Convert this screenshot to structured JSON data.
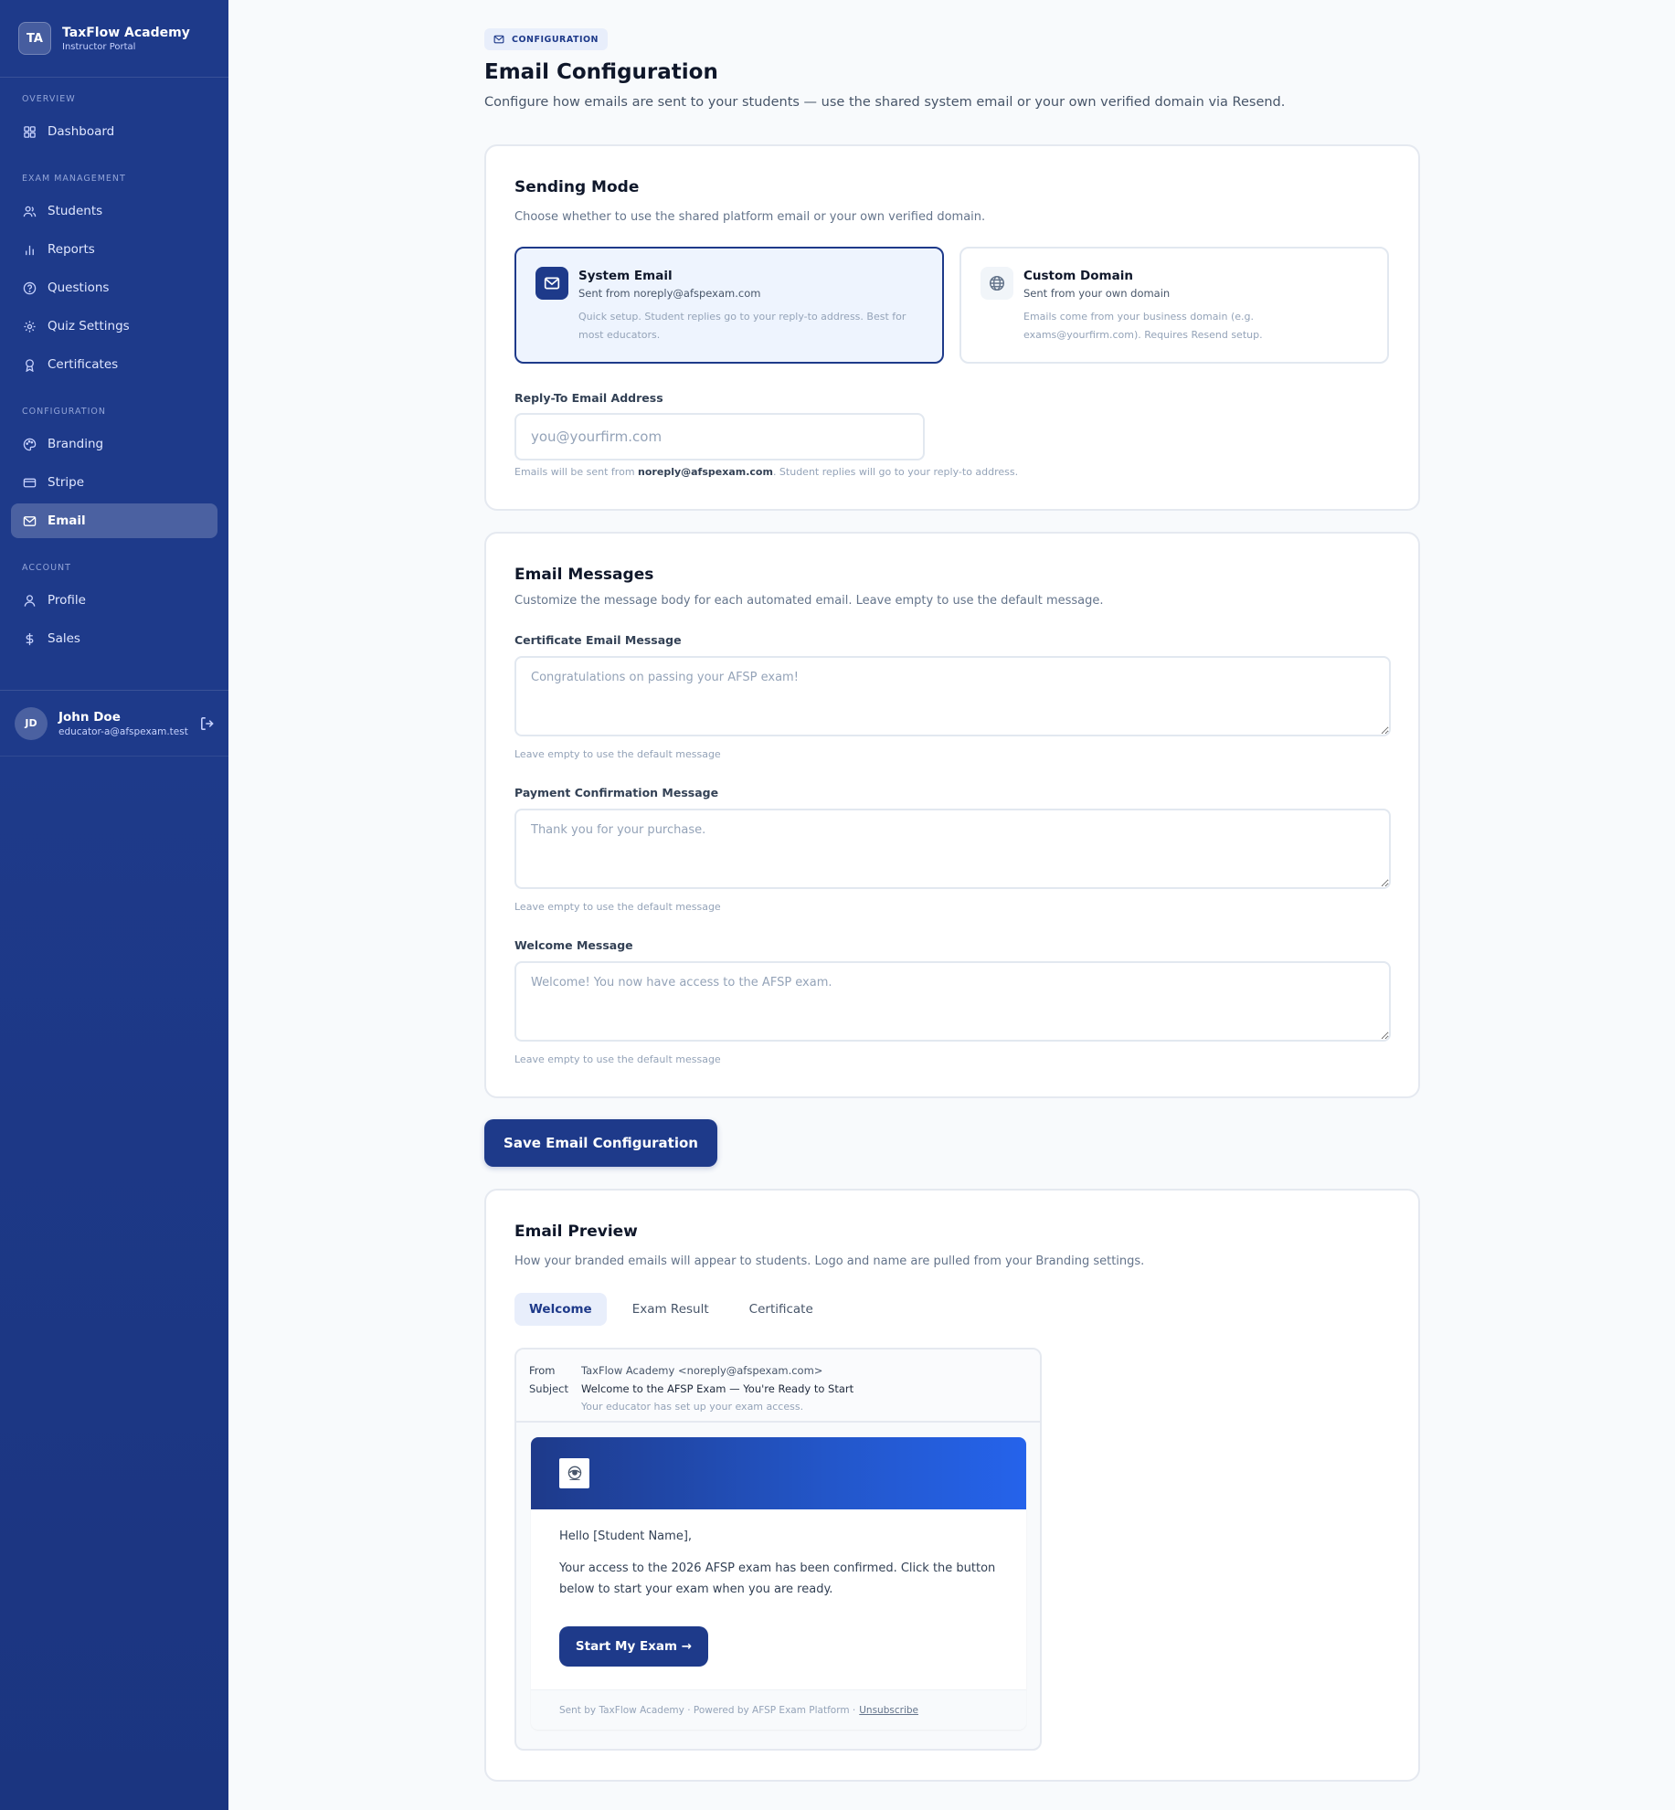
{
  "brand": {
    "initials": "TA",
    "name": "TaxFlow Academy",
    "subtitle": "Instructor Portal"
  },
  "nav": {
    "sections": [
      "OVERVIEW",
      "EXAM MANAGEMENT",
      "CONFIGURATION",
      "ACCOUNT"
    ],
    "items": [
      {
        "label": "Dashboard",
        "icon": "grid-icon"
      },
      {
        "label": "Students",
        "icon": "users-icon"
      },
      {
        "label": "Reports",
        "icon": "bar-chart-icon"
      },
      {
        "label": "Questions",
        "icon": "help-circle-icon"
      },
      {
        "label": "Quiz Settings",
        "icon": "gear-icon"
      },
      {
        "label": "Certificates",
        "icon": "award-icon"
      },
      {
        "label": "Branding",
        "icon": "palette-icon"
      },
      {
        "label": "Stripe",
        "icon": "credit-card-icon"
      },
      {
        "label": "Email",
        "icon": "mail-icon",
        "active": true
      },
      {
        "label": "Profile",
        "icon": "user-icon"
      },
      {
        "label": "Sales",
        "icon": "dollar-icon"
      }
    ]
  },
  "user": {
    "initials": "JD",
    "name": "John Doe",
    "email": "educator-a@afspexam.test"
  },
  "header": {
    "badge": "CONFIGURATION",
    "title": "Email Configuration",
    "subtitle": "Configure how emails are sent to your students — use the shared system email or your own verified domain via Resend."
  },
  "sending": {
    "title": "Sending Mode",
    "description": "Choose whether to use the shared platform email or your own verified domain.",
    "system": {
      "title": "System Email",
      "sub": "Sent from noreply@afspexam.com",
      "desc": "Quick setup. Student replies go to your reply-to address. Best for most educators."
    },
    "custom": {
      "title": "Custom Domain",
      "sub": "Sent from your own domain",
      "desc": "Emails come from your business domain (e.g. exams@yourfirm.com). Requires Resend setup."
    },
    "reply_label": "Reply-To Email Address",
    "reply_placeholder": "you@yourfirm.com",
    "hint_prefix": "Emails will be sent from",
    "hint_email": "noreply@afspexam.com",
    "hint_suffix": ". Student replies will go to your reply-to address."
  },
  "messages": {
    "title": "Email Messages",
    "description": "Customize the message body for each automated email. Leave empty to use the default message.",
    "certificate": {
      "label": "Certificate Email Message",
      "placeholder": "Congratulations on passing your AFSP exam!",
      "hint": "Leave empty to use the default message"
    },
    "payment": {
      "label": "Payment Confirmation Message",
      "placeholder": "Thank you for your purchase.",
      "hint": "Leave empty to use the default message"
    },
    "welcome": {
      "label": "Welcome Message",
      "placeholder": "Welcome! You now have access to the AFSP exam.",
      "hint": "Leave empty to use the default message"
    }
  },
  "save_label": "Save Email Configuration",
  "preview": {
    "title": "Email Preview",
    "description": "How your branded emails will appear to students. Logo and name are pulled from your Branding settings.",
    "tabs": [
      "Welcome",
      "Exam Result",
      "Certificate"
    ],
    "from_key": "From",
    "from_val": "TaxFlow Academy <noreply@afspexam.com>",
    "subject_key": "Subject",
    "subject_val": "Welcome to the AFSP Exam — You're Ready to Start",
    "preheader": "Your educator has set up your exam access.",
    "greeting": "Hello [Student Name],",
    "body": "Your access to the 2026 AFSP exam has been confirmed. Click the button below to start your exam when you are ready.",
    "cta": "Start My Exam →",
    "footer": "Sent by TaxFlow Academy · Powered by AFSP Exam Platform ·",
    "unsubscribe": "Unsubscribe"
  }
}
